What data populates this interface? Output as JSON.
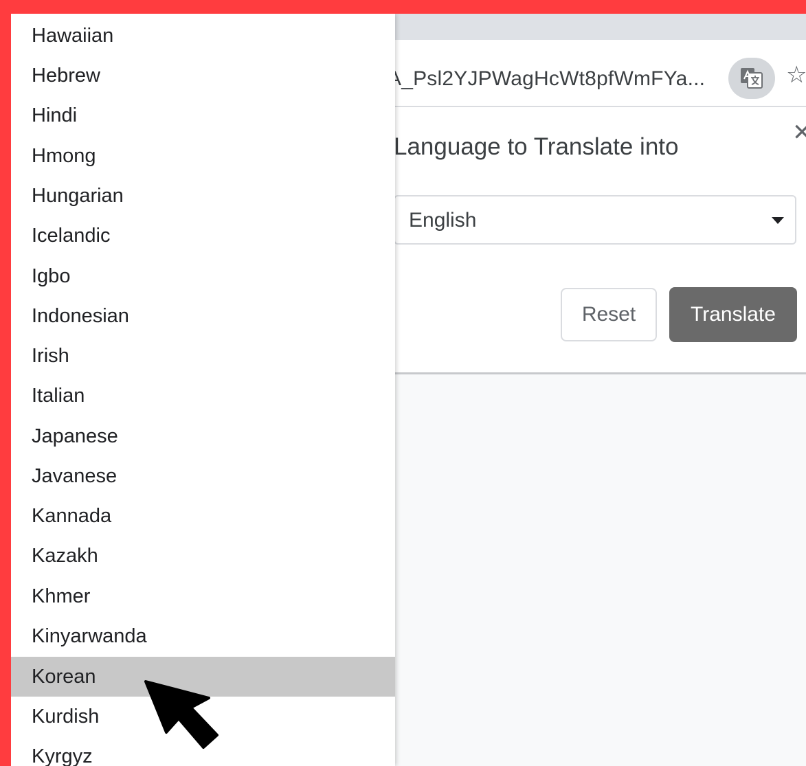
{
  "browser": {
    "url_text": "A_Psl2YJPWagHcWt8pfWmFYa...",
    "translate_icon": "translate-icon",
    "bookmark_icon": "star-icon"
  },
  "translate_bubble": {
    "title": "Language to Translate into",
    "close_icon": "close-icon",
    "selected_language": "English",
    "reset_label": "Reset",
    "translate_label": "Translate"
  },
  "language_list": {
    "items": [
      "Hawaiian",
      "Hebrew",
      "Hindi",
      "Hmong",
      "Hungarian",
      "Icelandic",
      "Igbo",
      "Indonesian",
      "Irish",
      "Italian",
      "Japanese",
      "Javanese",
      "Kannada",
      "Kazakh",
      "Khmer",
      "Kinyarwanda",
      "Korean",
      "Kurdish",
      "Kyrgyz"
    ],
    "highlighted": "Korean"
  },
  "colors": {
    "border_accent": "#ff3c3f",
    "highlight": "#c8c8c8",
    "primary_button": "#6a6a6a"
  }
}
